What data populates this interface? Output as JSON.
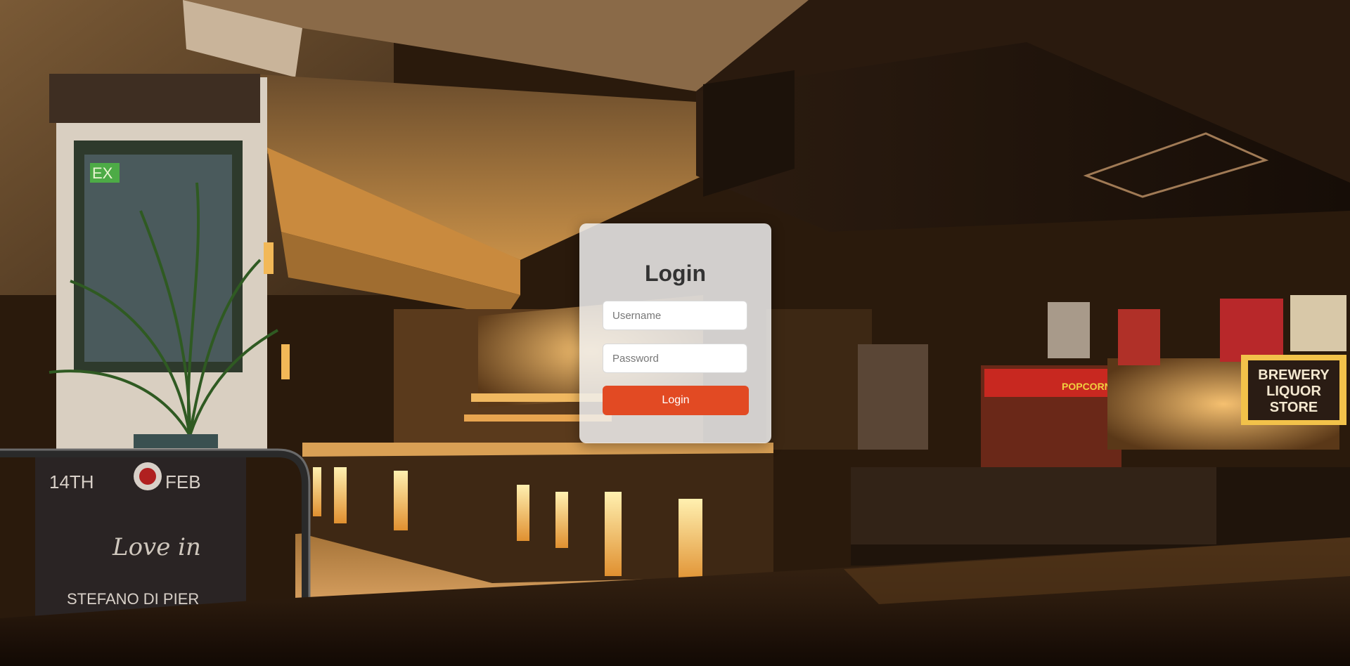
{
  "login": {
    "title": "Login",
    "username_placeholder": "Username",
    "username_value": "",
    "password_placeholder": "Password",
    "password_value": "",
    "button_label": "Login"
  },
  "background": {
    "exit_sign": "EX",
    "chalkboard_lines": [
      "14TH",
      "FEB",
      "Love in",
      "STEFANO DI PIER"
    ],
    "store_sign": [
      "BREWERY",
      "LIQUOR",
      "STORE"
    ],
    "popcorn_sign": "POPCORN"
  },
  "colors": {
    "button": "#e24a23",
    "card": "rgba(240,240,240,0.85)",
    "title": "#333333"
  }
}
